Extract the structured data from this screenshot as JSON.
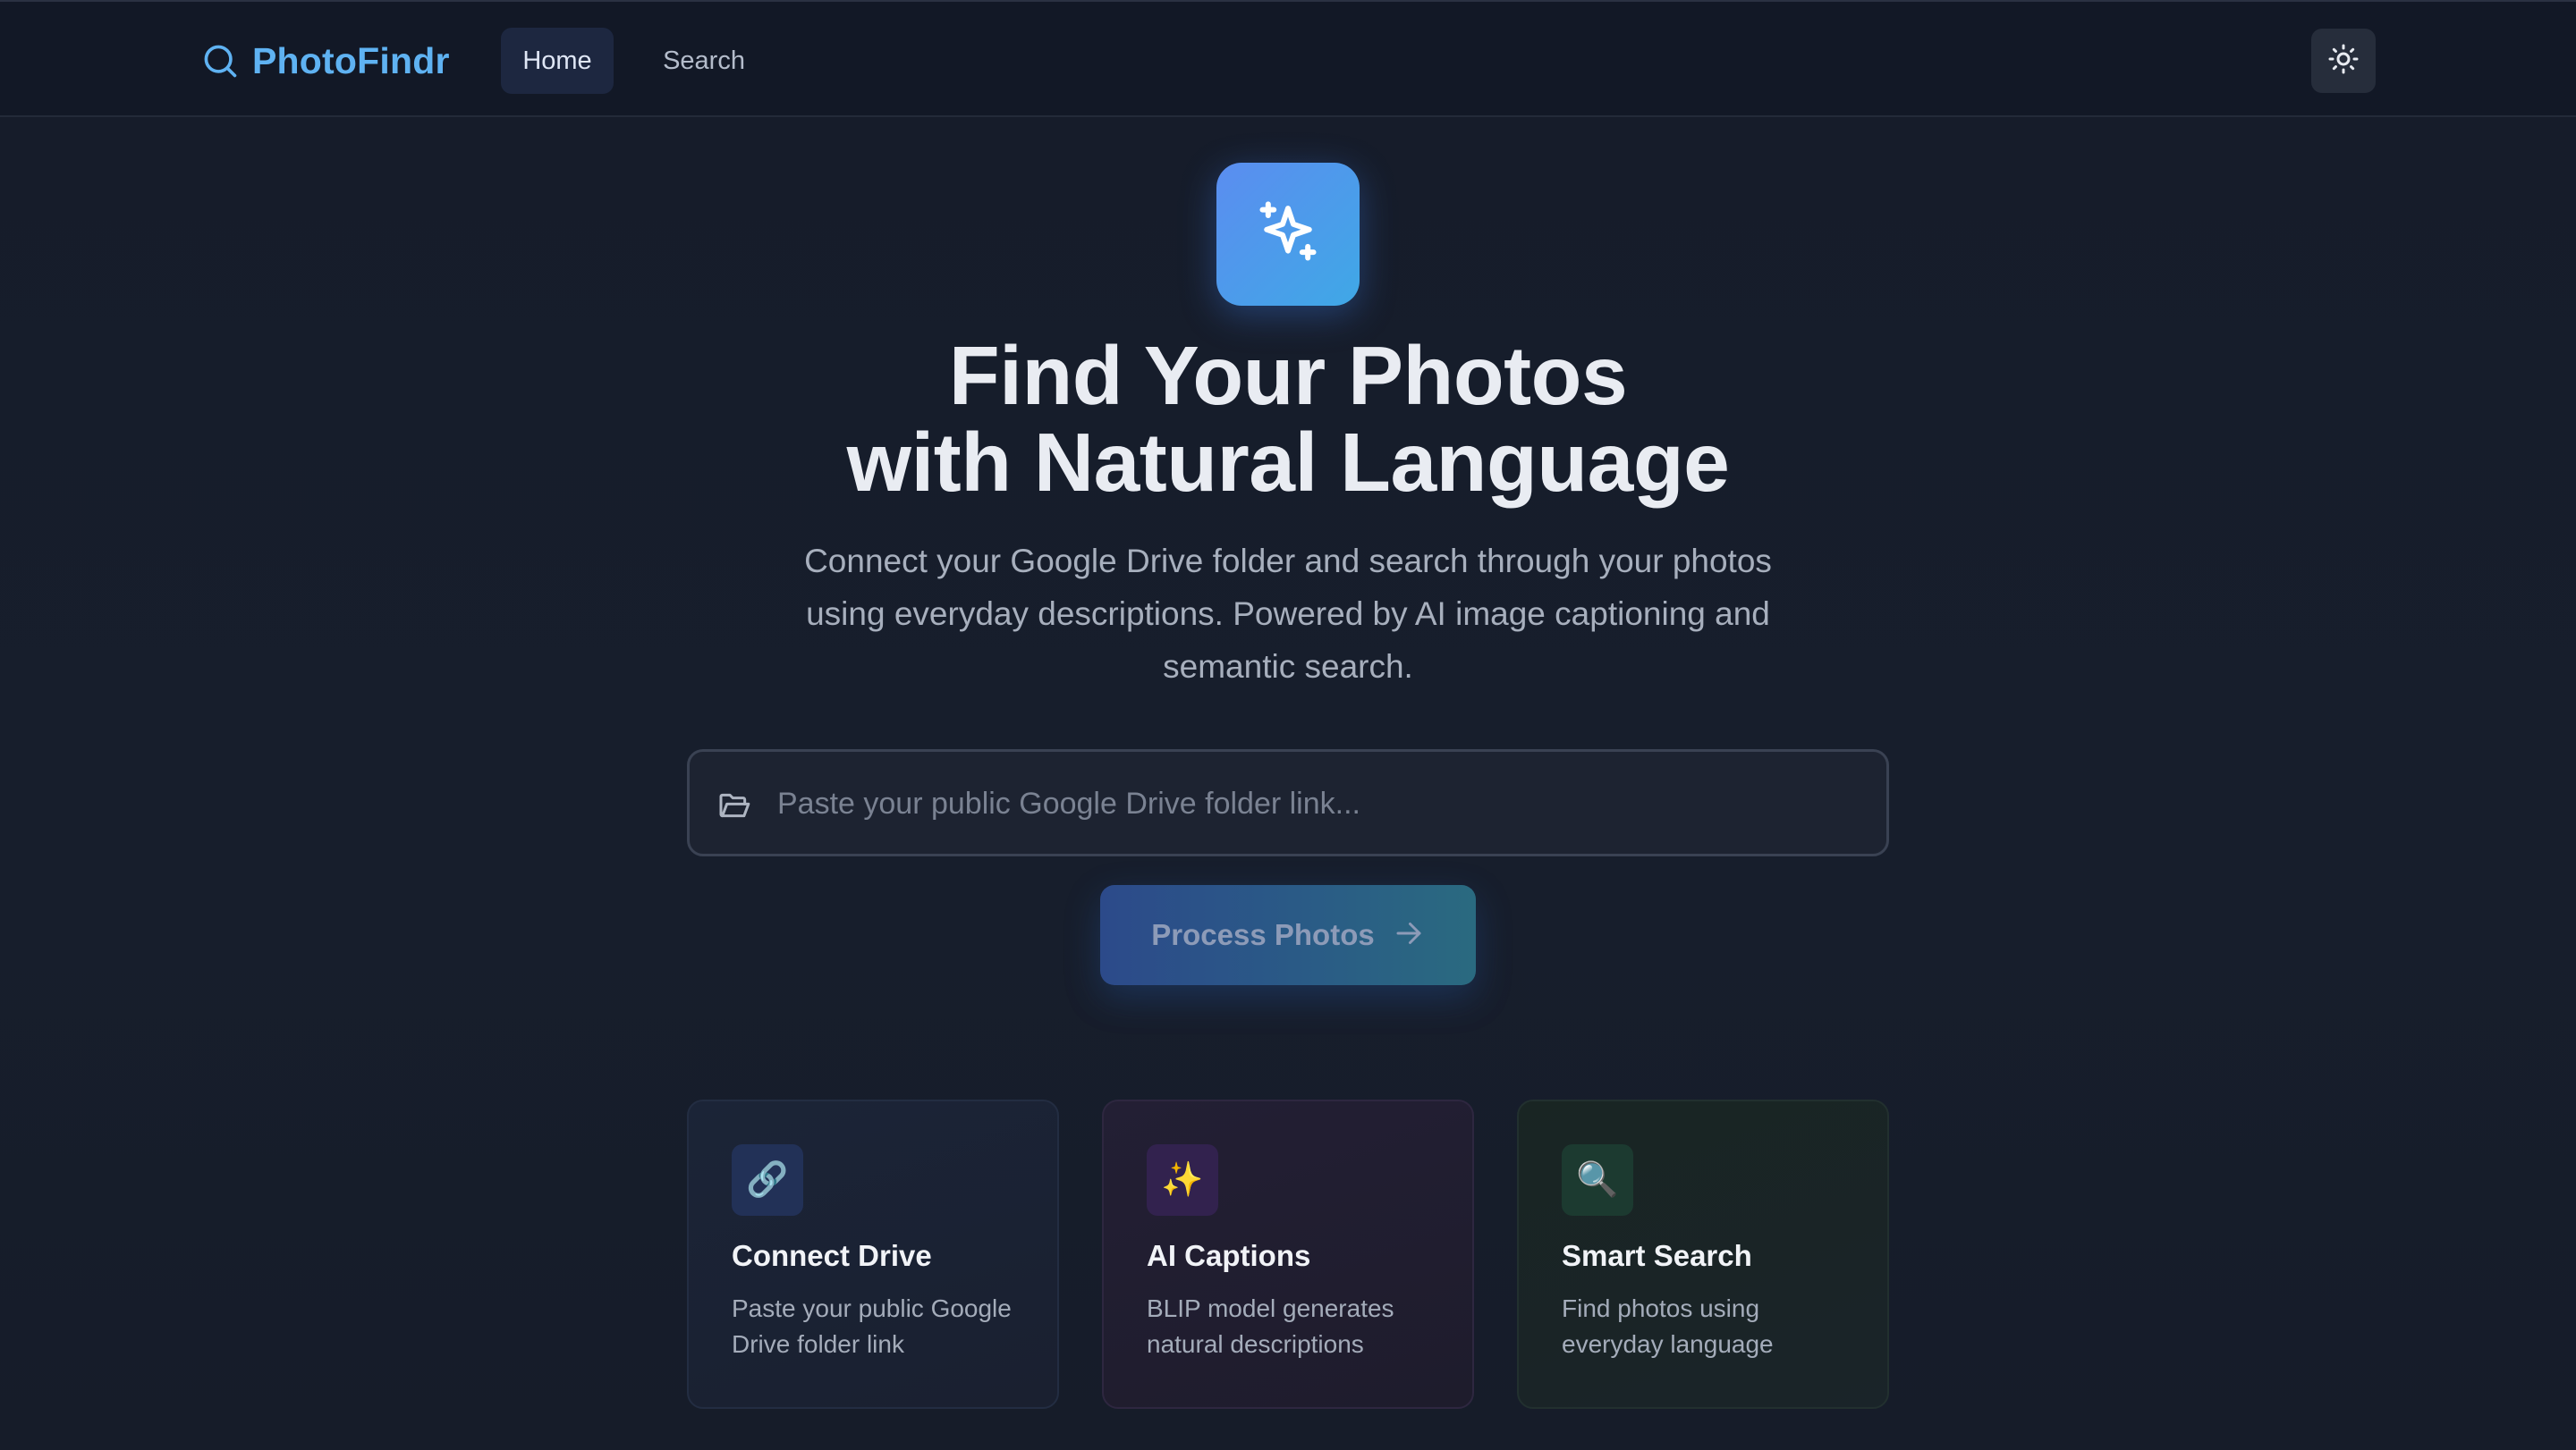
{
  "nav": {
    "brand": "PhotoFindr",
    "links": [
      {
        "label": "Home",
        "active": true
      },
      {
        "label": "Search",
        "active": false
      }
    ],
    "theme_toggle_icon": "sun-icon"
  },
  "hero": {
    "icon": "sparkles-icon",
    "title_line1": "Find Your Photos",
    "title_line2": "with Natural Language",
    "subtitle": "Connect your Google Drive folder and search through your photos using everyday descriptions. Powered by AI image captioning and semantic search."
  },
  "drive_input": {
    "icon": "folder-icon",
    "placeholder": "Paste your public Google Drive folder link...",
    "value": ""
  },
  "process_button": {
    "label": "Process Photos",
    "icon": "arrow-right-icon"
  },
  "features": [
    {
      "icon": "🔗",
      "icon_name": "link-icon",
      "title": "Connect Drive",
      "description": "Paste your public Google Drive folder link"
    },
    {
      "icon": "✨",
      "icon_name": "sparkles-icon",
      "title": "AI Captions",
      "description": "BLIP model generates natural descriptions"
    },
    {
      "icon": "🔍",
      "icon_name": "magnifier-icon",
      "title": "Smart Search",
      "description": "Find photos using everyday language"
    }
  ],
  "colors": {
    "brand": "#5fb2f2",
    "background": "#161c29",
    "navbar": "#121826",
    "hero_icon_gradient": [
      "#5b8df0",
      "#3fa8e6"
    ],
    "button_gradient": [
      "#2c4a8a",
      "#2a6a80"
    ]
  }
}
